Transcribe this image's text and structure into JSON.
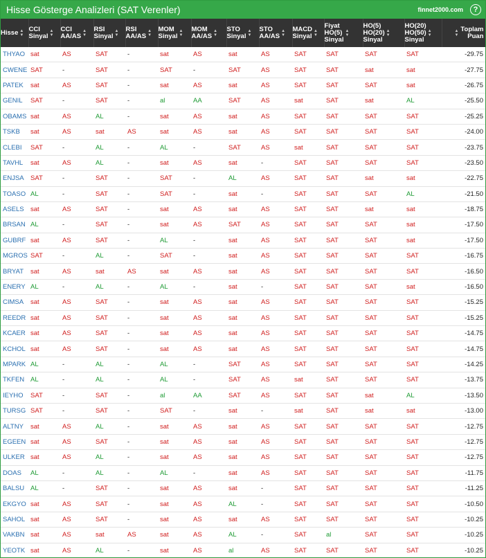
{
  "header": {
    "title": "Hisse Gösterge Analizleri (SAT Verenler)",
    "brand": "finnet2000.com",
    "help_icon": "?"
  },
  "colors": {
    "green": "#36a849",
    "red": "#d01c1c",
    "up": "#1d9a33",
    "link": "#2a6fb0",
    "header_bg": "#333333"
  },
  "columns": [
    {
      "label": "Hisse",
      "lines": [
        "Hisse"
      ]
    },
    {
      "label": "CCI Sinyal",
      "lines": [
        "CCI",
        "Sinyal"
      ]
    },
    {
      "label": "CCI AA/AS",
      "lines": [
        "CCI",
        "AA/AS"
      ]
    },
    {
      "label": "RSI Sinyal",
      "lines": [
        "RSI",
        "Sinyal"
      ]
    },
    {
      "label": "RSI AA/AS",
      "lines": [
        "RSI",
        "AA/AS"
      ]
    },
    {
      "label": "MOM Sinyal",
      "lines": [
        "MOM",
        "Sinyal"
      ]
    },
    {
      "label": "MOM AA/AS",
      "lines": [
        "MOM",
        "AA/AS"
      ]
    },
    {
      "label": "STO Sinyal",
      "lines": [
        "STO",
        "Sinyal"
      ]
    },
    {
      "label": "STO AA/AS",
      "lines": [
        "STO",
        "AA/AS"
      ]
    },
    {
      "label": "MACD Sinyal",
      "lines": [
        "MACD",
        "Sinyal"
      ]
    },
    {
      "label": "Fiyat HO(5) Sinyal",
      "lines": [
        "Fiyat",
        "HO(5)",
        "Sinyal"
      ]
    },
    {
      "label": "HO(5) HO(20) Sinyal",
      "lines": [
        "HO(5)",
        "HO(20)",
        "Sinyal"
      ]
    },
    {
      "label": "HO(20) HO(50) Sinyal",
      "lines": [
        "HO(20)",
        "HO(50)",
        "Sinyal"
      ]
    },
    {
      "label": "Toplam Puan",
      "lines": [
        "Toplam",
        "Puan"
      ]
    }
  ],
  "rows": [
    [
      "THYAO",
      "sat",
      "AS",
      "SAT",
      "-",
      "sat",
      "AS",
      "sat",
      "AS",
      "SAT",
      "SAT",
      "SAT",
      "SAT",
      "-29.75"
    ],
    [
      "CWENE",
      "SAT",
      "-",
      "SAT",
      "-",
      "SAT",
      "-",
      "SAT",
      "AS",
      "SAT",
      "SAT",
      "sat",
      "sat",
      "-27.75"
    ],
    [
      "PATEK",
      "sat",
      "AS",
      "SAT",
      "-",
      "sat",
      "AS",
      "sat",
      "AS",
      "SAT",
      "SAT",
      "SAT",
      "sat",
      "-26.75"
    ],
    [
      "GENIL",
      "SAT",
      "-",
      "SAT",
      "-",
      "al",
      "AA",
      "SAT",
      "AS",
      "sat",
      "SAT",
      "sat",
      "AL",
      "-25.50"
    ],
    [
      "OBAMS",
      "sat",
      "AS",
      "AL",
      "-",
      "sat",
      "AS",
      "sat",
      "AS",
      "SAT",
      "SAT",
      "SAT",
      "SAT",
      "-25.25"
    ],
    [
      "TSKB",
      "sat",
      "AS",
      "sat",
      "AS",
      "sat",
      "AS",
      "sat",
      "AS",
      "SAT",
      "SAT",
      "SAT",
      "SAT",
      "-24.00"
    ],
    [
      "CLEBI",
      "SAT",
      "-",
      "AL",
      "-",
      "AL",
      "-",
      "SAT",
      "AS",
      "sat",
      "SAT",
      "SAT",
      "SAT",
      "-23.75"
    ],
    [
      "TAVHL",
      "sat",
      "AS",
      "AL",
      "-",
      "sat",
      "AS",
      "sat",
      "-",
      "SAT",
      "SAT",
      "SAT",
      "SAT",
      "-23.50"
    ],
    [
      "ENJSA",
      "SAT",
      "-",
      "SAT",
      "-",
      "SAT",
      "-",
      "AL",
      "AS",
      "SAT",
      "SAT",
      "sat",
      "sat",
      "-22.75"
    ],
    [
      "TOASO",
      "AL",
      "-",
      "SAT",
      "-",
      "SAT",
      "-",
      "sat",
      "-",
      "SAT",
      "SAT",
      "SAT",
      "AL",
      "-21.50"
    ],
    [
      "ASELS",
      "sat",
      "AS",
      "SAT",
      "-",
      "sat",
      "AS",
      "sat",
      "AS",
      "SAT",
      "SAT",
      "sat",
      "sat",
      "-18.75"
    ],
    [
      "BRSAN",
      "AL",
      "-",
      "SAT",
      "-",
      "sat",
      "AS",
      "SAT",
      "AS",
      "SAT",
      "SAT",
      "SAT",
      "sat",
      "-17.50"
    ],
    [
      "GUBRF",
      "sat",
      "AS",
      "SAT",
      "-",
      "AL",
      "-",
      "sat",
      "AS",
      "SAT",
      "SAT",
      "SAT",
      "sat",
      "-17.50"
    ],
    [
      "MGROS",
      "SAT",
      "-",
      "AL",
      "-",
      "SAT",
      "-",
      "sat",
      "AS",
      "SAT",
      "SAT",
      "SAT",
      "SAT",
      "-16.75"
    ],
    [
      "BRYAT",
      "sat",
      "AS",
      "sat",
      "AS",
      "sat",
      "AS",
      "sat",
      "AS",
      "SAT",
      "SAT",
      "SAT",
      "SAT",
      "-16.50"
    ],
    [
      "ENERY",
      "AL",
      "-",
      "AL",
      "-",
      "AL",
      "-",
      "sat",
      "-",
      "SAT",
      "SAT",
      "SAT",
      "sat",
      "-16.50"
    ],
    [
      "CIMSA",
      "sat",
      "AS",
      "SAT",
      "-",
      "sat",
      "AS",
      "sat",
      "AS",
      "SAT",
      "SAT",
      "SAT",
      "SAT",
      "-15.25"
    ],
    [
      "REEDR",
      "sat",
      "AS",
      "SAT",
      "-",
      "sat",
      "AS",
      "sat",
      "AS",
      "SAT",
      "SAT",
      "SAT",
      "SAT",
      "-15.25"
    ],
    [
      "KCAER",
      "sat",
      "AS",
      "SAT",
      "-",
      "sat",
      "AS",
      "sat",
      "AS",
      "SAT",
      "SAT",
      "SAT",
      "SAT",
      "-14.75"
    ],
    [
      "KCHOL",
      "sat",
      "AS",
      "SAT",
      "-",
      "sat",
      "AS",
      "sat",
      "AS",
      "SAT",
      "SAT",
      "SAT",
      "SAT",
      "-14.75"
    ],
    [
      "MPARK",
      "AL",
      "-",
      "AL",
      "-",
      "AL",
      "-",
      "SAT",
      "AS",
      "SAT",
      "SAT",
      "SAT",
      "SAT",
      "-14.25"
    ],
    [
      "TKFEN",
      "AL",
      "-",
      "AL",
      "-",
      "AL",
      "-",
      "SAT",
      "AS",
      "sat",
      "SAT",
      "SAT",
      "SAT",
      "-13.75"
    ],
    [
      "IEYHO",
      "SAT",
      "-",
      "SAT",
      "-",
      "al",
      "AA",
      "SAT",
      "AS",
      "SAT",
      "SAT",
      "sat",
      "AL",
      "-13.50"
    ],
    [
      "TURSG",
      "SAT",
      "-",
      "SAT",
      "-",
      "SAT",
      "-",
      "sat",
      "-",
      "sat",
      "SAT",
      "sat",
      "sat",
      "-13.00"
    ],
    [
      "ALTNY",
      "sat",
      "AS",
      "AL",
      "-",
      "sat",
      "AS",
      "sat",
      "AS",
      "SAT",
      "SAT",
      "SAT",
      "SAT",
      "-12.75"
    ],
    [
      "EGEEN",
      "sat",
      "AS",
      "SAT",
      "-",
      "sat",
      "AS",
      "sat",
      "AS",
      "SAT",
      "SAT",
      "SAT",
      "SAT",
      "-12.75"
    ],
    [
      "ULKER",
      "sat",
      "AS",
      "AL",
      "-",
      "sat",
      "AS",
      "sat",
      "AS",
      "SAT",
      "SAT",
      "SAT",
      "SAT",
      "-12.75"
    ],
    [
      "DOAS",
      "AL",
      "-",
      "AL",
      "-",
      "AL",
      "-",
      "sat",
      "AS",
      "SAT",
      "SAT",
      "SAT",
      "SAT",
      "-11.75"
    ],
    [
      "BALSU",
      "AL",
      "-",
      "SAT",
      "-",
      "sat",
      "AS",
      "sat",
      "-",
      "SAT",
      "SAT",
      "SAT",
      "SAT",
      "-11.25"
    ],
    [
      "EKGYO",
      "sat",
      "AS",
      "SAT",
      "-",
      "sat",
      "AS",
      "AL",
      "-",
      "SAT",
      "SAT",
      "SAT",
      "SAT",
      "-10.50"
    ],
    [
      "SAHOL",
      "sat",
      "AS",
      "SAT",
      "-",
      "sat",
      "AS",
      "sat",
      "AS",
      "SAT",
      "SAT",
      "SAT",
      "SAT",
      "-10.25"
    ],
    [
      "VAKBN",
      "sat",
      "AS",
      "sat",
      "AS",
      "sat",
      "AS",
      "AL",
      "-",
      "SAT",
      "al",
      "SAT",
      "SAT",
      "-10.25"
    ],
    [
      "YEOTK",
      "sat",
      "AS",
      "AL",
      "-",
      "sat",
      "AS",
      "al",
      "AS",
      "SAT",
      "SAT",
      "SAT",
      "SAT",
      "-10.25"
    ]
  ]
}
